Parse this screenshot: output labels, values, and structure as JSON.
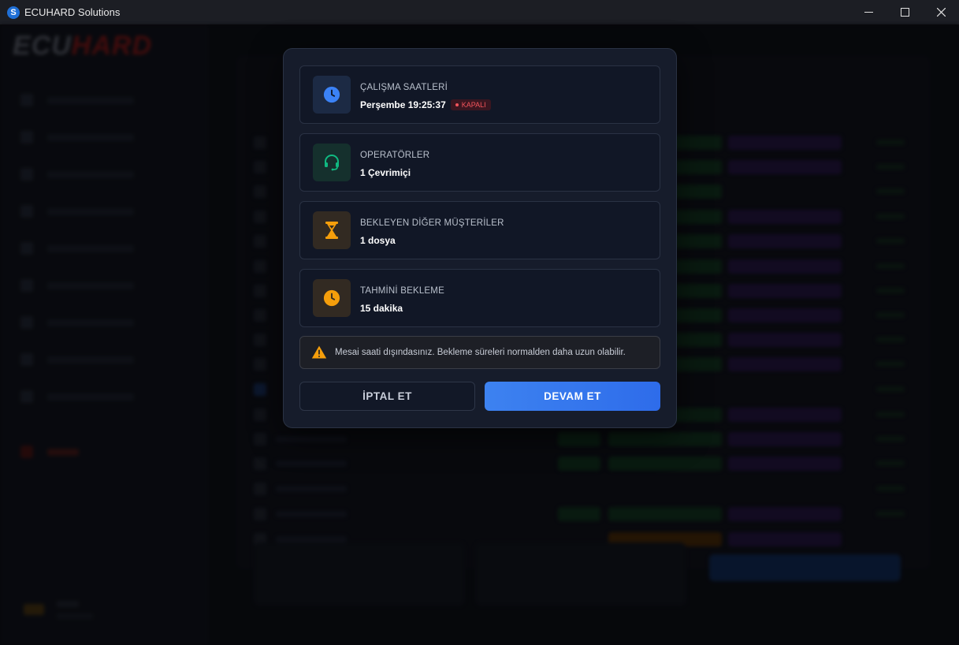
{
  "window": {
    "title": "ECUHARD Solutions",
    "controls": {
      "minimize": "—",
      "maximize": "☐",
      "close": "✕"
    }
  },
  "background_app": {
    "brand_left": "ECU",
    "brand_right": "HARD"
  },
  "modal": {
    "cards": [
      {
        "label": "ÇALIŞMA SAATLERİ",
        "value": "Perşembe  19:25:37",
        "badge": "KAPALI",
        "icon": "clock-icon",
        "icon_color": "#3b82f6",
        "icon_bg": "#1c2a44"
      },
      {
        "label": "OPERATÖRLER",
        "value": "1  Çevrimiçi",
        "icon": "headset-icon",
        "icon_color": "#10b981",
        "icon_bg": "#15302d"
      },
      {
        "label": "BEKLEYEN DİĞER MÜŞTERİLER",
        "value": "1  dosya",
        "icon": "hourglass-icon",
        "icon_color": "#f59e0b",
        "icon_bg": "#322a22"
      },
      {
        "label": "TAHMİNİ BEKLEME",
        "value": "15  dakika",
        "icon": "clock-icon",
        "icon_color": "#f59e0b",
        "icon_bg": "#322a22"
      }
    ],
    "warning": {
      "icon": "warning-icon",
      "text": "Mesai saati dışındasınız. Bekleme süreleri normalden daha uzun olabilir."
    },
    "cancel_label": "İPTAL ET",
    "continue_label": "DEVAM ET"
  },
  "colors": {
    "accent": "#3b82f6",
    "danger": "#f2545b",
    "success": "#10b981",
    "warning": "#f59e0b"
  }
}
